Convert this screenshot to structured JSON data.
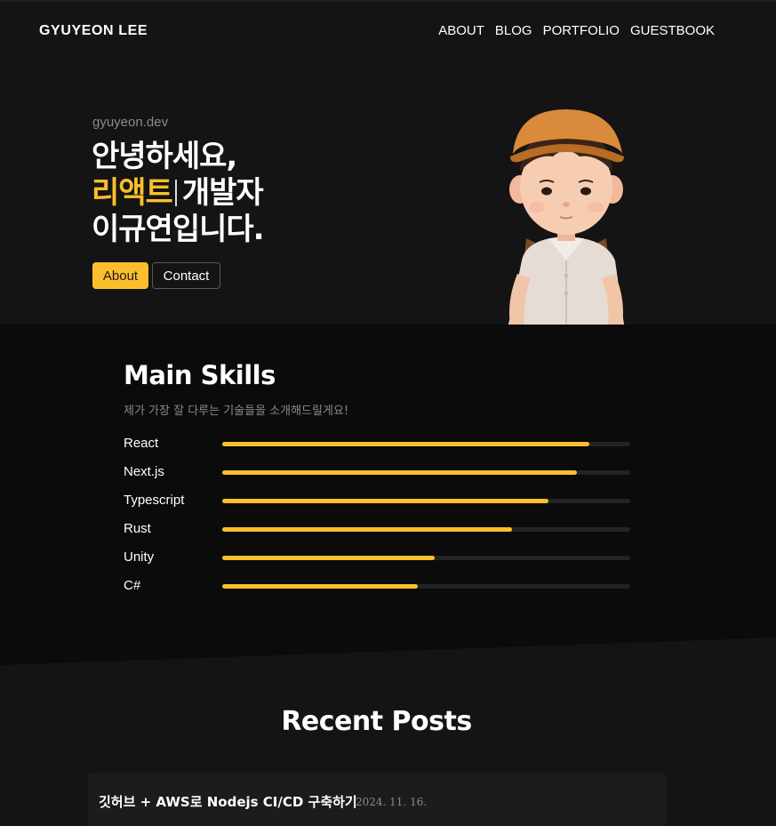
{
  "header": {
    "brand": "GYUYEON  LEE",
    "nav": [
      {
        "label": "ABOUT"
      },
      {
        "label": "BLOG"
      },
      {
        "label": "PORTFOLIO"
      },
      {
        "label": "GUESTBOOK"
      }
    ]
  },
  "hero": {
    "domain": "gyuyeon.dev",
    "greeting": "안녕하세요,",
    "role_accent": "리액트",
    "role_suffix": "개발자",
    "name_line": "이규연입니다.",
    "buttons": {
      "about": "About",
      "contact": "Contact"
    },
    "accent_color": "#fbbf2b"
  },
  "skills": {
    "title": "Main Skills",
    "subtitle": "제가 가장 잘 다루는 기술들을 소개해드릴게요!",
    "items": [
      {
        "name": "React",
        "level": 0.9
      },
      {
        "name": "Next.js",
        "level": 0.87
      },
      {
        "name": "Typescript",
        "level": 0.8
      },
      {
        "name": "Rust",
        "level": 0.71
      },
      {
        "name": "Unity",
        "level": 0.52
      },
      {
        "name": "C#",
        "level": 0.48
      }
    ]
  },
  "posts": {
    "title": "Recent Posts",
    "items": [
      {
        "title": "깃허브 + AWS로 Nodejs CI/CD 구축하기",
        "date": "2024. 11. 16."
      }
    ]
  }
}
